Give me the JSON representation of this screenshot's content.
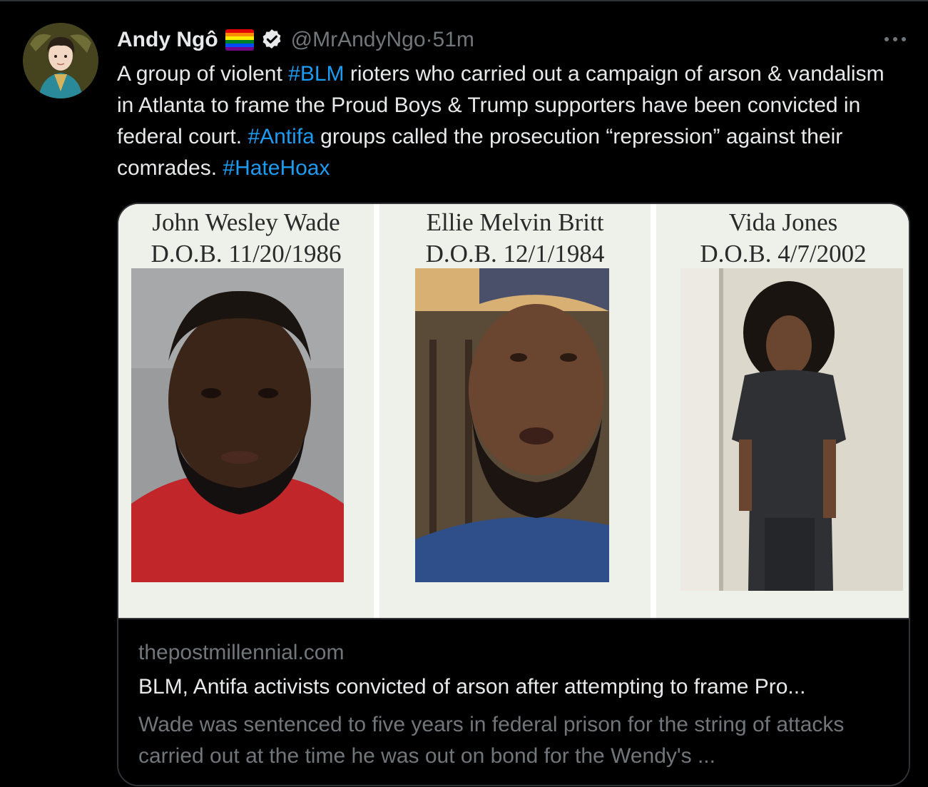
{
  "tweet": {
    "author_name": "Andy Ngô",
    "handle": "@MrAndyNgo",
    "separator": " · ",
    "time": "51m",
    "text_parts": {
      "p1": "A group of violent ",
      "tag1": "#BLM",
      "p2": " rioters who carried out a campaign of arson & vandalism in Atlanta to frame the Proud Boys & Trump supporters have been convicted in federal court. ",
      "tag2": "#Antifa",
      "p3": " groups called the prosecution “repression” against their comrades. ",
      "tag3": "#HateHoax"
    },
    "icons": {
      "flag": "rainbow-flag-icon",
      "verified": "verified-badge-icon",
      "more": "more-options-icon"
    }
  },
  "card": {
    "panels": [
      {
        "name": "John Wesley Wade",
        "dob": "D.O.B. 11/20/1986"
      },
      {
        "name": "Ellie Melvin Britt",
        "dob": "D.O.B. 12/1/1984"
      },
      {
        "name": "Vida Jones",
        "dob": "D.O.B. 4/7/2002"
      }
    ],
    "domain": "thepostmillennial.com",
    "title": "BLM, Antifa activists convicted of arson after attempting to frame Pro...",
    "description": "Wade was sentenced to five years in federal prison for the string of attacks carried out at the time he was out on bond for the Wendy's ..."
  },
  "colors": {
    "background": "#000000",
    "text": "#e7e9ea",
    "secondary_text": "#71767b",
    "hashtag": "#1d9bf0",
    "border": "#2f3336"
  }
}
